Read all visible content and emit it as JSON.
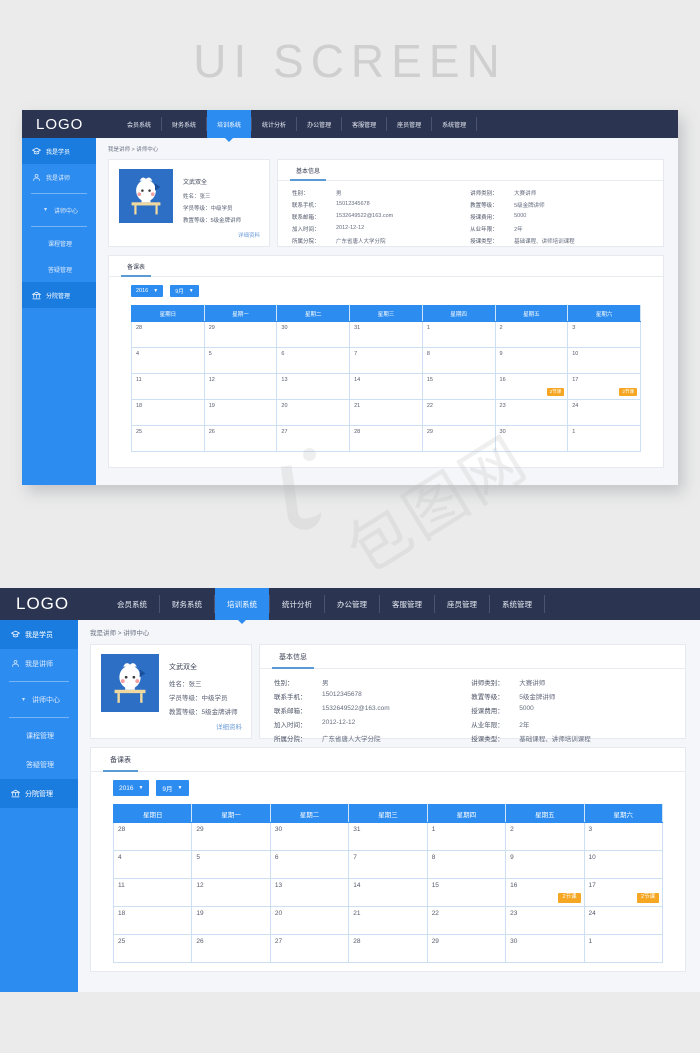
{
  "poster": {
    "title": "UI SCREEN",
    "watermark": "包图网"
  },
  "header": {
    "logo": "LOGO",
    "nav": [
      {
        "label": "会员系统",
        "active": false
      },
      {
        "label": "财务系统",
        "active": false
      },
      {
        "label": "培训系统",
        "active": true
      },
      {
        "label": "统计分析",
        "active": false
      },
      {
        "label": "办公管理",
        "active": false
      },
      {
        "label": "客服管理",
        "active": false
      },
      {
        "label": "座员管理",
        "active": false
      },
      {
        "label": "系统管理",
        "active": false
      }
    ]
  },
  "sidebar": {
    "items": [
      {
        "label": "我是学员",
        "icon": "graduation-cap-icon",
        "selected": true,
        "level": 0
      },
      {
        "label": "我是讲师",
        "icon": "teacher-icon",
        "selected": false,
        "level": 0
      },
      {
        "label": "讲师中心",
        "icon": "caret-icon",
        "selected": false,
        "level": 1
      },
      {
        "label": "课程管理",
        "icon": "",
        "selected": false,
        "level": 2
      },
      {
        "label": "答疑管理",
        "icon": "",
        "selected": false,
        "level": 2
      },
      {
        "label": "分院管理",
        "icon": "bank-icon",
        "selected": true,
        "level": 0
      }
    ]
  },
  "main": {
    "breadcrumb": "我是讲师 > 讲师中心",
    "profile": {
      "avatar_alt": "卡通头像",
      "nickname": "文武双全",
      "rows": [
        {
          "label": "姓名：",
          "value": "张三"
        },
        {
          "label": "学员等级：",
          "value": "中级学员"
        },
        {
          "label": "教置等级：",
          "value": "5级金牌讲师"
        }
      ],
      "detail_link": "详细资料"
    },
    "info_card": {
      "tabs": [
        {
          "label": "基本信息",
          "active": true
        }
      ],
      "left_rows": [
        {
          "label": "性别：",
          "value": "男"
        },
        {
          "label": "联系手机：",
          "value": "15012345678"
        },
        {
          "label": "联系邮箱：",
          "value": "1532649522@163.com"
        },
        {
          "label": "加入时间：",
          "value": "2012-12-12"
        },
        {
          "label": "所属分院：",
          "value": "广东省唐人大学分院"
        }
      ],
      "right_rows": [
        {
          "label": "讲师类别：",
          "value": "大赛讲师"
        },
        {
          "label": "教置等级：",
          "value": "5级金牌讲师"
        },
        {
          "label": "授课费用：",
          "value": "5000"
        },
        {
          "label": "从业年限：",
          "value": "2年"
        },
        {
          "label": "授课类型：",
          "value": "基础课程、讲师培训课程"
        }
      ]
    },
    "calendar": {
      "tabs": [
        {
          "label": "备课表",
          "active": true
        }
      ],
      "year_select": "2016",
      "month_select": "9月",
      "caret": "▼",
      "weekdays": [
        "星期日",
        "星期一",
        "星期二",
        "星期三",
        "星期四",
        "星期五",
        "星期六"
      ],
      "weeks": [
        [
          {
            "day": "28",
            "muted": true,
            "badge": ""
          },
          {
            "day": "29",
            "muted": true,
            "badge": ""
          },
          {
            "day": "30",
            "muted": true,
            "badge": ""
          },
          {
            "day": "31",
            "muted": true,
            "badge": ""
          },
          {
            "day": "1",
            "muted": false,
            "badge": ""
          },
          {
            "day": "2",
            "muted": false,
            "badge": ""
          },
          {
            "day": "3",
            "muted": false,
            "badge": ""
          }
        ],
        [
          {
            "day": "4",
            "muted": false,
            "badge": ""
          },
          {
            "day": "5",
            "muted": false,
            "badge": ""
          },
          {
            "day": "6",
            "muted": false,
            "badge": ""
          },
          {
            "day": "7",
            "muted": false,
            "badge": ""
          },
          {
            "day": "8",
            "muted": false,
            "badge": ""
          },
          {
            "day": "9",
            "muted": false,
            "badge": ""
          },
          {
            "day": "10",
            "muted": false,
            "badge": ""
          }
        ],
        [
          {
            "day": "11",
            "muted": false,
            "badge": ""
          },
          {
            "day": "12",
            "muted": false,
            "badge": ""
          },
          {
            "day": "13",
            "muted": false,
            "badge": ""
          },
          {
            "day": "14",
            "muted": false,
            "badge": ""
          },
          {
            "day": "15",
            "muted": false,
            "badge": ""
          },
          {
            "day": "16",
            "muted": false,
            "badge": "2节课"
          },
          {
            "day": "17",
            "muted": false,
            "badge": "2节课"
          }
        ],
        [
          {
            "day": "18",
            "muted": false,
            "badge": ""
          },
          {
            "day": "19",
            "muted": false,
            "badge": ""
          },
          {
            "day": "20",
            "muted": false,
            "badge": ""
          },
          {
            "day": "21",
            "muted": false,
            "badge": ""
          },
          {
            "day": "22",
            "muted": false,
            "badge": ""
          },
          {
            "day": "23",
            "muted": false,
            "badge": ""
          },
          {
            "day": "24",
            "muted": false,
            "badge": ""
          }
        ],
        [
          {
            "day": "25",
            "muted": false,
            "badge": ""
          },
          {
            "day": "26",
            "muted": false,
            "badge": ""
          },
          {
            "day": "27",
            "muted": false,
            "badge": ""
          },
          {
            "day": "28",
            "muted": false,
            "badge": ""
          },
          {
            "day": "29",
            "muted": false,
            "badge": ""
          },
          {
            "day": "30",
            "muted": false,
            "badge": ""
          },
          {
            "day": "1",
            "muted": true,
            "badge": ""
          }
        ]
      ]
    }
  },
  "colors": {
    "header_bg": "#2b3552",
    "accent_blue": "#2d8cf0",
    "badge_orange": "#f5a623",
    "page_bg": "#ebebeb"
  }
}
